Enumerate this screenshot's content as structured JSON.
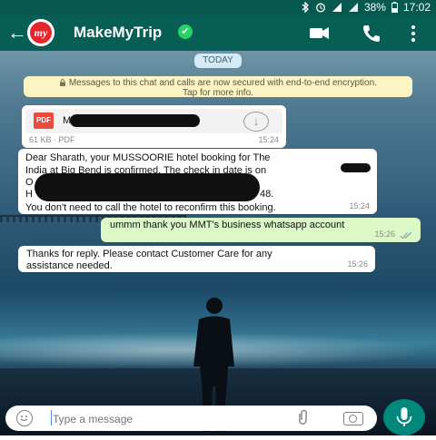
{
  "status_bar": {
    "battery": "38%",
    "time": "17:02"
  },
  "header": {
    "back_icon": "back-arrow-icon",
    "contact_name": "MakeMyTrip",
    "logo_text": "my",
    "verified_badge": "✔",
    "icons": [
      "video-call-icon",
      "phone-call-icon",
      "more-options-icon"
    ]
  },
  "chat": {
    "date_label": "TODAY",
    "encryption_notice": {
      "line1": "Messages to this chat and calls are now secured with end-to-end encryption.",
      "line2": "Tap for more info."
    },
    "messages": [
      {
        "type": "document",
        "icon_label": "PDF",
        "file_prefix": "M",
        "size": "61 KB",
        "format": "PDF",
        "meta": "61 KB · PDF",
        "time": "15:24"
      },
      {
        "type": "text",
        "direction": "in",
        "line1": "Dear Sharath, your MUSSOORIE hotel booking for The",
        "line2": "India at Big Bend is confirmed. The check in date is on",
        "line3_prefix": "O",
        "line4_prefix": "H",
        "line4_suffix": "48.",
        "line5": "You don't need to call the hotel to reconfirm this booking.",
        "time": "15:24"
      },
      {
        "type": "text",
        "direction": "out",
        "text": "ummm thank you MMT's business whatsapp account",
        "time": "15:26",
        "status": "read"
      },
      {
        "type": "text",
        "direction": "in",
        "line1": "Thanks for reply. Please contact Customer Care for any",
        "line2": "assistance needed.",
        "time": "15:26"
      }
    ]
  },
  "input": {
    "placeholder": "Type a message"
  },
  "colors": {
    "header": "#075e54",
    "outgoing_bubble": "#dcf8c6",
    "incoming_bubble": "#ffffff",
    "notice_bg": "#fdf4c5",
    "mic_button": "#00897b"
  }
}
